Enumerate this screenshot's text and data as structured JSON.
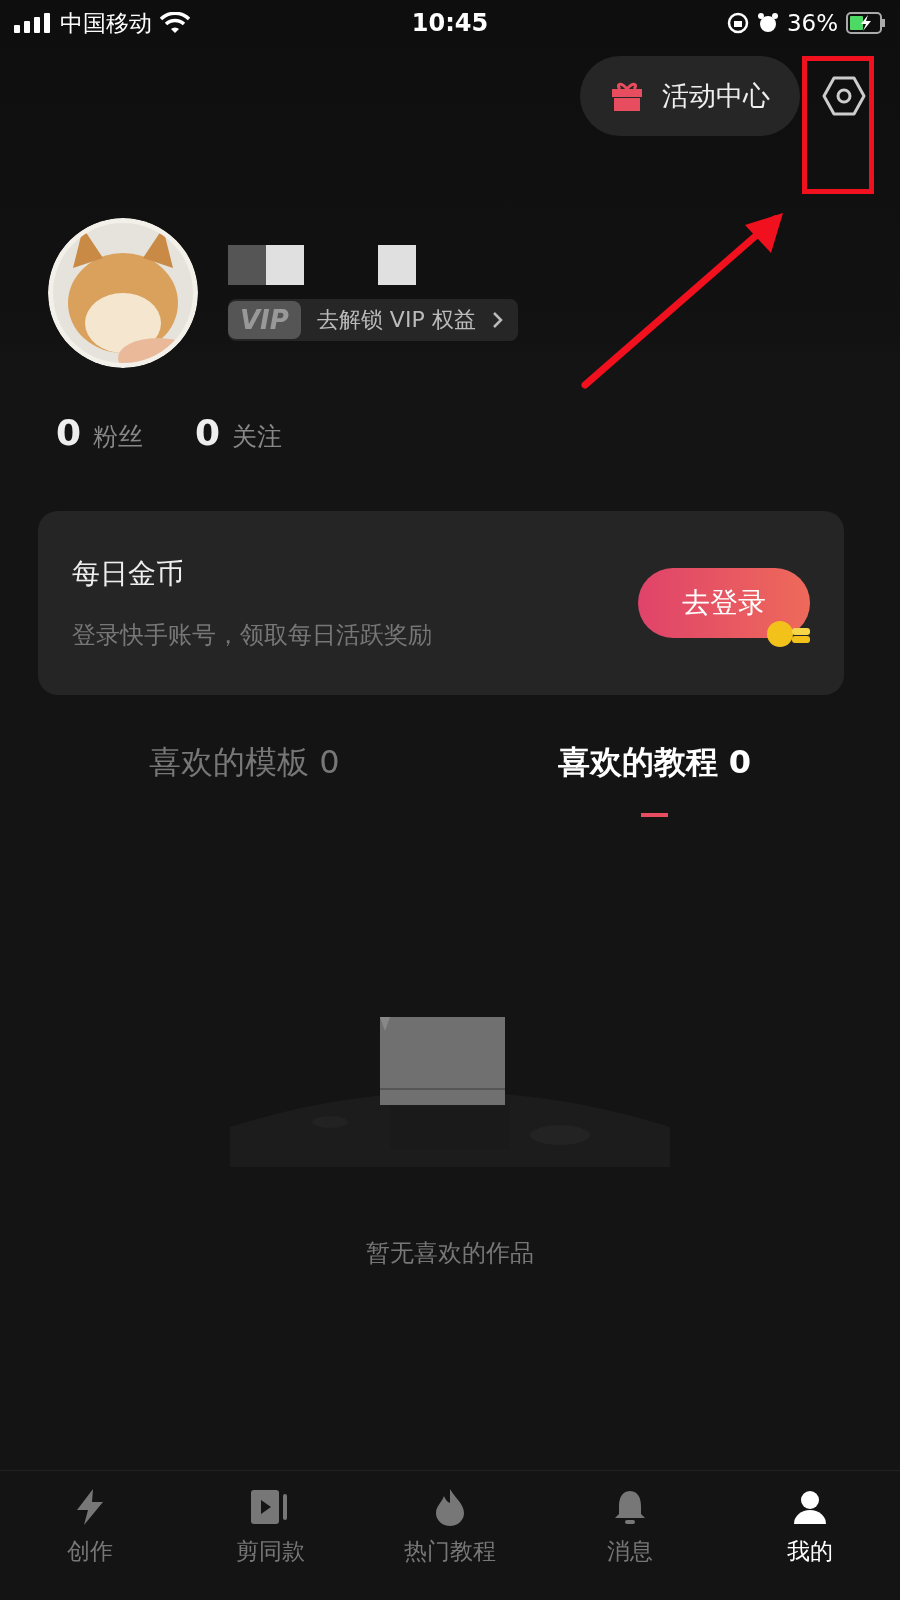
{
  "status_bar": {
    "carrier": "中国移动",
    "time": "10:45",
    "battery": "36%"
  },
  "header": {
    "activity_button": "活动中心"
  },
  "profile": {
    "vip_label": "VIP",
    "vip_link": "去解锁 VIP 权益"
  },
  "stats": [
    {
      "value": "0",
      "label": "粉丝"
    },
    {
      "value": "0",
      "label": "关注"
    }
  ],
  "coins_card": {
    "title": "每日金币",
    "subtitle": "登录快手账号，领取每日活跃奖励",
    "button": "去登录"
  },
  "tabs": [
    {
      "label": "喜欢的模板 0",
      "selected": false
    },
    {
      "label": "喜欢的教程 0",
      "selected": true
    }
  ],
  "empty_state": {
    "message": "暂无喜欢的作品"
  },
  "bottom_nav": [
    {
      "kind": "bolt",
      "label": "创作",
      "selected": false
    },
    {
      "kind": "video",
      "label": "剪同款",
      "selected": false
    },
    {
      "kind": "flame",
      "label": "热门教程",
      "selected": false
    },
    {
      "kind": "bell",
      "label": "消息",
      "selected": false
    },
    {
      "kind": "user",
      "label": "我的",
      "selected": true
    }
  ]
}
